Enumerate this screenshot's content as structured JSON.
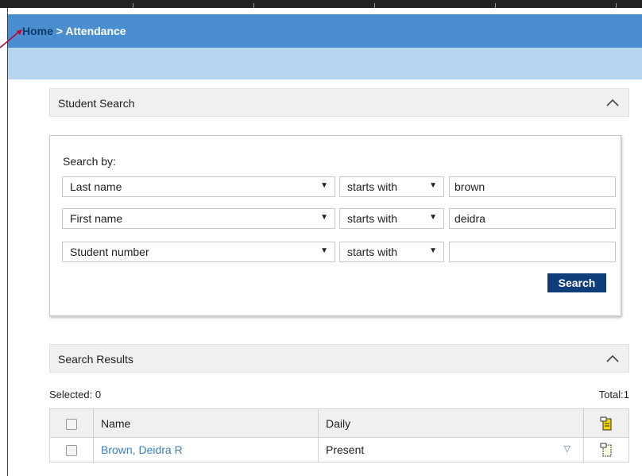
{
  "breadcrumb": {
    "home": "Home",
    "separator": " > ",
    "current": "Attendance"
  },
  "student_search": {
    "title": "Student Search",
    "search_by_label": "Search by:",
    "rows": [
      {
        "field": "Last name",
        "operator": "starts with",
        "value": "brown"
      },
      {
        "field": "First name",
        "operator": "starts with",
        "value": "deidra"
      },
      {
        "field": "Student number",
        "operator": "starts with",
        "value": ""
      }
    ],
    "search_button": "Search"
  },
  "search_results": {
    "title": "Search Results",
    "selected_label": "Selected: 0",
    "total_label": "Total:1",
    "columns": {
      "name": "Name",
      "daily": "Daily"
    },
    "rows": [
      {
        "name": "Brown, Deidra R",
        "daily": "Present"
      }
    ]
  },
  "icons": {
    "collapse": "chevron-up-icon",
    "dropdown": "triangle-down-icon",
    "note": "note-icon"
  },
  "colors": {
    "breadcrumb_bar": "#4a8ed0",
    "sub_bar": "#b7d4ef",
    "button": "#0f3d7a",
    "link": "#3a7fb8"
  }
}
